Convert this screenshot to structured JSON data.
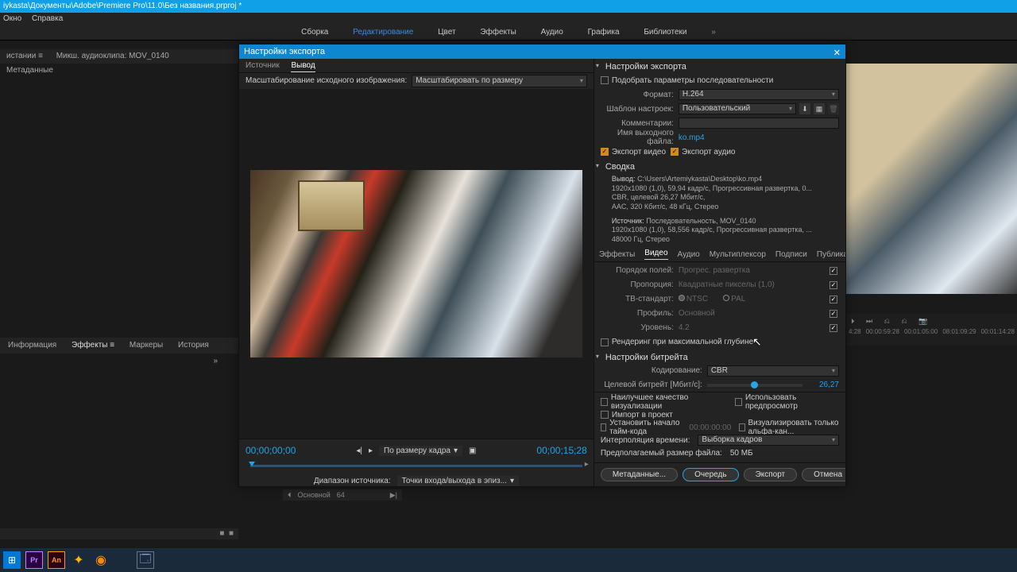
{
  "titlebar": "iykasta\\Документы\\Adobe\\Premiere Pro\\11.0\\Без названия.prproj *",
  "menubar": {
    "item1": "Окно",
    "item2": "Справка"
  },
  "workspace": {
    "tab1": "Сборка",
    "tab2": "Редактирование",
    "tab3": "Цвет",
    "tab4": "Эффекты",
    "tab5": "Аудио",
    "tab6": "Графика",
    "tab7": "Библиотеки",
    "more": "»"
  },
  "bg_left_tabs": {
    "t1": "истании  ≡",
    "t2": "Микш. аудиоклипа: MOV_0140",
    "t3": "Метаданные"
  },
  "bg_left_effects": {
    "t1": "Информация",
    "t2": "Эффекты  ≡",
    "t3": "Маркеры",
    "t4": "История",
    "more": "»"
  },
  "bg_timeline": {
    "ruler": [
      "4:28",
      "00:00:59:28",
      "00:01:05:00",
      "08:01:09:29",
      "00:01:14:28"
    ]
  },
  "dialog": {
    "title": "Настройки экспорта",
    "left": {
      "tabs": {
        "src": "Источник",
        "out": "Вывод"
      },
      "scale_label": "Масштабирование исходного изображения:",
      "scale_value": "Масштабировать по размеру",
      "tc_in": "00;00;00;00",
      "fit_label": "По размеру кадра",
      "tc_out": "00;00;15;28",
      "range_label": "Диапазон источника:",
      "range_value": "Точки входа/выхода в эпиз..."
    },
    "right": {
      "section_export": "Настройки экспорта",
      "match_seq": "Подобрать параметры последовательности",
      "format_label": "Формат:",
      "format_value": "H.264",
      "preset_label": "Шаблон настроек:",
      "preset_value": "Пользовательский",
      "comments_label": "Комментарии:",
      "outname_label": "Имя выходного файла:",
      "outname_value": "ko.mp4",
      "export_video": "Экспорт видео",
      "export_audio": "Экспорт аудио",
      "summary_head": "Сводка",
      "summary_out_label": "Вывод:",
      "summary_out_l1": "C:\\Users\\Artemiykasta\\Desktop\\ko.mp4",
      "summary_out_l2": "1920x1080 (1,0), 59,94 кадр/с, Прогрессивная развертка, 0...",
      "summary_out_l3": "CBR, целевой 26,27 Мбит/с,",
      "summary_out_l4": "AAC, 320 Кбит/с, 48 кГц, Стерео",
      "summary_src_label": "Источник:",
      "summary_src_l1": "Последовательность, MOV_0140",
      "summary_src_l2": "1920x1080 (1,0), 58,556 кадр/с, Прогрессивная развертка, ...",
      "summary_src_l3": "48000 Гц, Стерео",
      "stabs": {
        "fx": "Эффекты",
        "video": "Видео",
        "audio": "Аудио",
        "mux": "Мультиплексор",
        "cap": "Подписи",
        "pub": "Публикац...",
        "more": "»"
      },
      "fields_order_label": "Порядок полей:",
      "fields_order_value": "Прогрес. развертка",
      "aspect_label": "Пропорция:",
      "aspect_value": "Квадратные пикселы (1,0)",
      "tv_label": "ТВ-стандарт:",
      "tv_ntsc": "NTSC",
      "tv_pal": "PAL",
      "profile_label": "Профиль:",
      "profile_value": "Основной",
      "level_label": "Уровень:",
      "level_value": "4.2",
      "max_depth": "Рендеринг при максимальной глубине",
      "bitrate_head": "Настройки битрейта",
      "encoding_label": "Кодирование:",
      "encoding_value": "CBR",
      "target_label": "Целевой битрейт [Мбит/с]:",
      "target_value": "26,27",
      "chk_best": "Наилучшее качество визуализации",
      "chk_preview": "Использовать предпросмотр",
      "chk_import": "Импорт в проект",
      "chk_tc": "Установить начало тайм-кода",
      "chk_tc_val": "00:00:00:00",
      "chk_alpha": "Визуализировать только альфа-кан...",
      "interp_label": "Интерполяция времени:",
      "interp_value": "Выборка кадров",
      "est_label": "Предполагаемый размер файла:",
      "est_value": "50 МБ",
      "btn_meta": "Метаданные...",
      "btn_queue": "Очередь",
      "btn_export": "Экспорт",
      "btn_cancel": "Отмена"
    }
  },
  "timeline_strip": {
    "label": "Основной",
    "num": "64"
  },
  "taskbar": {
    "pr": "Pr",
    "an": "An"
  }
}
